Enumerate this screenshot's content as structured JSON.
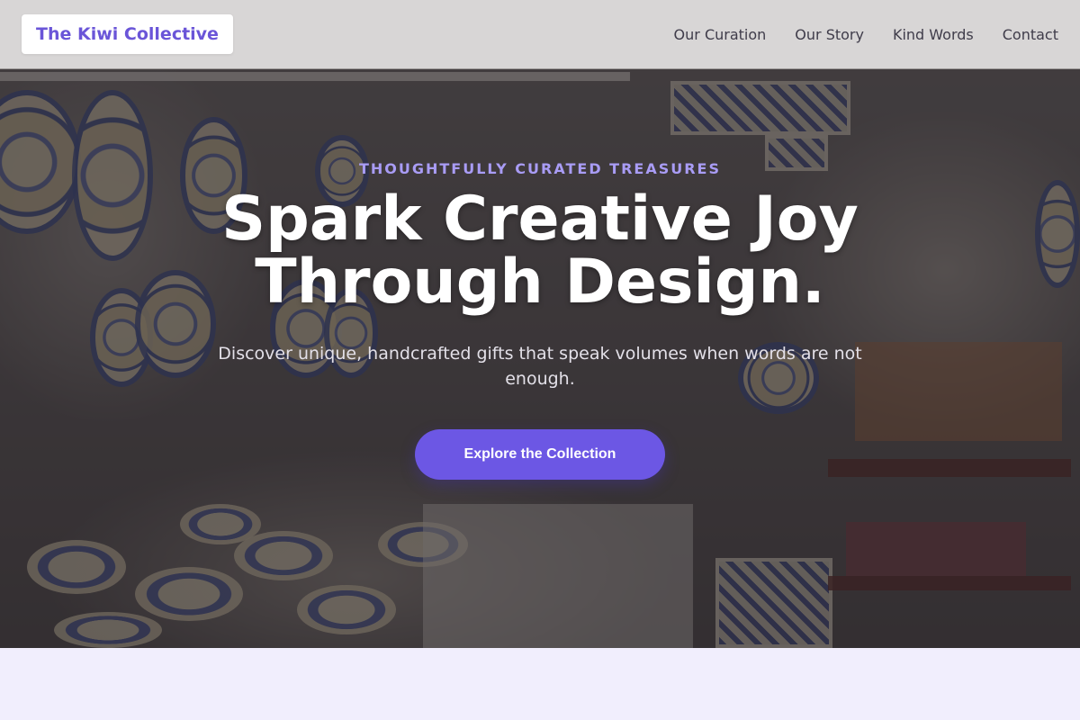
{
  "nav": {
    "brand": "The Kiwi Collective",
    "links": [
      "Our Curation",
      "Our Story",
      "Kind Words",
      "Contact"
    ]
  },
  "hero": {
    "eyebrow": "THOUGHTFULLY CURATED TREASURES",
    "headline": "Spark Creative Joy Through Design.",
    "subtext": "Discover unique, handcrafted gifts that speak volumes when words are not enough.",
    "cta_label": "Explore the Collection",
    "background_image": "ceramics-shop-photo"
  },
  "colors": {
    "accent": "#6c57e4",
    "brand_text": "#6a55d8",
    "eyebrow": "#a99cf5",
    "section_bg": "#f1eefd"
  }
}
